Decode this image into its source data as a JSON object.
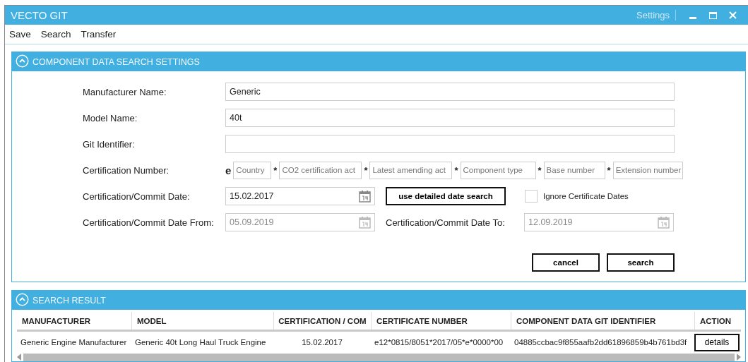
{
  "window": {
    "title": "VECTO GIT",
    "settings": "Settings"
  },
  "menu": [
    "Save",
    "Search",
    "Transfer"
  ],
  "settings_panel": {
    "title": "COMPONENT DATA SEARCH SETTINGS",
    "expanded": true,
    "fields": [
      {
        "label": "Manufacturer Name:",
        "value": "Generic"
      },
      {
        "label": "Model Name:",
        "value": "40t"
      },
      {
        "label": "Git Identifier:"
      }
    ],
    "certification": {
      "label": "Certification Number:",
      "prefix": "e",
      "parts": [
        {
          "placeholder": "Country"
        },
        {
          "placeholder": "CO2 certification act"
        },
        {
          "placeholder": "Latest amending act"
        },
        {
          "placeholder": "Component type"
        },
        {
          "placeholder": "Base number"
        },
        {
          "placeholder": "Extension number"
        }
      ],
      "separator": "*"
    },
    "commit_date": {
      "label": "Certification/Commit Date:",
      "value": "15.02.2017",
      "disabled": false
    },
    "detailed_button": "use detailed date search",
    "ignore_dates": {
      "label": "Ignore Certificate Dates",
      "checked": false
    },
    "date_from": {
      "label": "Certification/Commit Date From:",
      "value": "05.09.2019",
      "disabled": true
    },
    "date_to": {
      "label": "Certification/Commit Date To:",
      "value": "12.09.2019",
      "disabled": true
    },
    "buttons": [
      "cancel",
      "search"
    ]
  },
  "result_panel": {
    "title": "SEARCH RESULT",
    "expanded": true,
    "columns": [
      "MANUFACTURER",
      "MODEL",
      "CERTIFICATION / COM",
      "CERTIFICATE NUMBER",
      "COMPONENT DATA GIT IDENTIFIER",
      "ACTION"
    ],
    "rows": [
      {
        "cells": [
          "Generic Engine Manufacturer",
          "Generic 40t Long Haul Truck Engine",
          "15.02.2017",
          "e12*0815/8051*2017/05*e*0000*00",
          "04885ccbac9f855aafb2dd61896859b4b761bd3f"
        ],
        "action": "details"
      }
    ]
  }
}
